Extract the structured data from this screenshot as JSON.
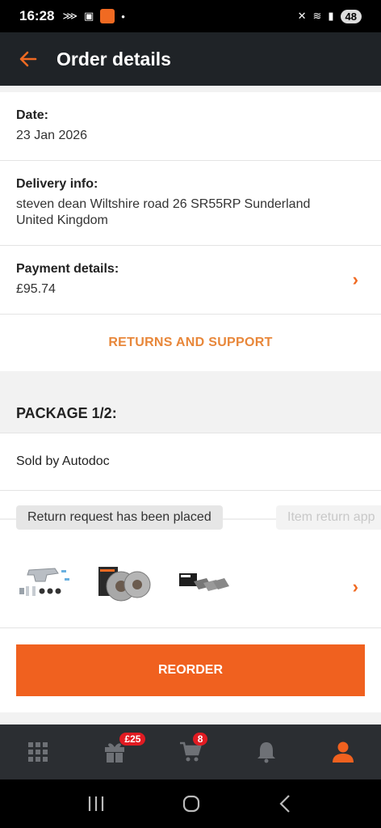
{
  "status_bar": {
    "time": "16:28",
    "app_icon_text": "AUTO DOC",
    "battery": "48"
  },
  "header": {
    "title": "Order details"
  },
  "order": {
    "date_label": "Date:",
    "date_value": "23 Jan 2026",
    "delivery_label": "Delivery info:",
    "delivery_value": "steven dean Wiltshire road 26 SR55RP Sunderland United Kingdom",
    "payment_label": "Payment details:",
    "payment_value": "£95.74",
    "returns_link": "RETURNS AND SUPPORT"
  },
  "package": {
    "header": "PACKAGE 1/2:",
    "sold_by": "Sold by Autodoc",
    "steps": [
      "Return request has been placed",
      "Item return app"
    ],
    "products": [
      {
        "icon": "brake-caliper-bracket-kit-icon"
      },
      {
        "icon": "brake-discs-icon"
      },
      {
        "icon": "brake-pads-icon"
      }
    ],
    "reorder_label": "REORDER"
  },
  "bottom_nav": {
    "items": [
      {
        "icon": "grid-icon"
      },
      {
        "icon": "gift-icon",
        "badge": "£25"
      },
      {
        "icon": "cart-icon",
        "badge": "8"
      },
      {
        "icon": "bell-icon"
      },
      {
        "icon": "profile-icon"
      }
    ],
    "active_color": "#f0611f"
  },
  "colors": {
    "accent": "#f0611f",
    "link": "#e8873a",
    "appbar": "#1f2327"
  }
}
